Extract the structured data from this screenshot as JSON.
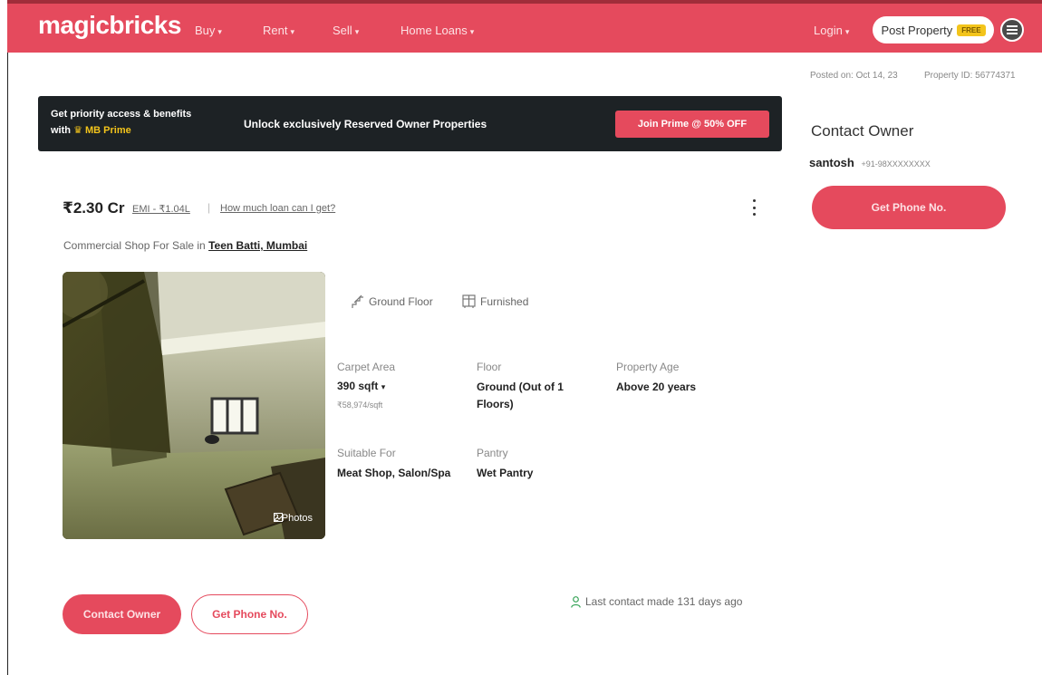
{
  "header": {
    "logo": "magicbricks",
    "nav": [
      {
        "label": "Buy"
      },
      {
        "label": "Rent"
      },
      {
        "label": "Sell"
      },
      {
        "label": "Home Loans"
      }
    ],
    "login_label": "Login",
    "post_property_label": "Post Property",
    "free_badge": "FREE"
  },
  "meta": {
    "posted_on": "Posted on: Oct 14, 23",
    "property_id": "Property ID: 56774371"
  },
  "prime_banner": {
    "line1": "Get priority access & benefits",
    "line2_prefix": "with",
    "brand": "MB Prime",
    "headline": "Unlock exclusively Reserved Owner Properties",
    "cta": "Join Prime @ 50% OFF"
  },
  "listing": {
    "price": "₹2.30 Cr",
    "emi": "EMI - ₹1.04L",
    "separator": "|",
    "loan_link": "How much loan can I get?",
    "subtitle_prefix": "Commercial Shop For Sale in",
    "locality": "Teen Batti, Mumbai",
    "photo_count": "2 Photos",
    "amenities": [
      "Ground Floor",
      "Furnished"
    ],
    "details": {
      "carpet_area": {
        "label": "Carpet Area",
        "value": "390 sqft",
        "sub": "₹58,974/sqft"
      },
      "floor": {
        "label": "Floor",
        "value_line1": "Ground (Out of 1",
        "value_line2": "Floors)"
      },
      "property_age": {
        "label": "Property Age",
        "value": "Above 20 years"
      },
      "suitable_for": {
        "label": "Suitable For",
        "value": "Meat Shop, Salon/Spa"
      },
      "pantry": {
        "label": "Pantry",
        "value": "Wet Pantry"
      }
    },
    "contact_owner_btn": "Contact Owner",
    "get_phone_btn": "Get Phone No.",
    "last_contact": "Last contact made 131 days ago"
  },
  "sidebar": {
    "title": "Contact Owner",
    "owner_name": "santosh",
    "owner_phone": "+91-98XXXXXXXX",
    "cta": "Get Phone No."
  },
  "colors": {
    "brand": "#e54a5d",
    "banner_bg": "#1d2225",
    "prime_gold": "#f3c41b"
  }
}
